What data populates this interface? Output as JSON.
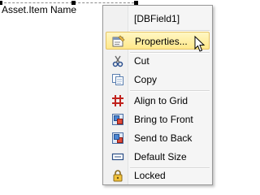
{
  "field": {
    "text": "Asset.Item Name"
  },
  "menu": {
    "header": "[DBField1]",
    "items": [
      {
        "label": "Properties...",
        "icon": "properties-icon"
      },
      {
        "label": "Cut",
        "icon": "scissors-icon"
      },
      {
        "label": "Copy",
        "icon": "copy-icon"
      },
      {
        "label": "Align to Grid",
        "icon": "grid-icon"
      },
      {
        "label": "Bring to Front",
        "icon": "bring-to-front-icon"
      },
      {
        "label": "Send to Back",
        "icon": "send-to-back-icon"
      },
      {
        "label": "Default Size",
        "icon": "default-size-icon"
      },
      {
        "label": "Locked",
        "icon": "lock-icon"
      }
    ],
    "highlighted_item": "Properties..."
  }
}
